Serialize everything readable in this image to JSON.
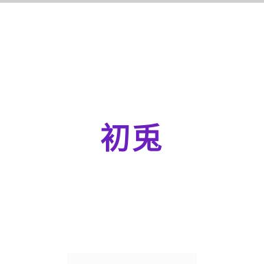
{
  "screen": {
    "title": "初兎"
  },
  "colors": {
    "top_bar": "#cfcfcf",
    "background": "#ffffff",
    "title": "#6b1fbf"
  }
}
